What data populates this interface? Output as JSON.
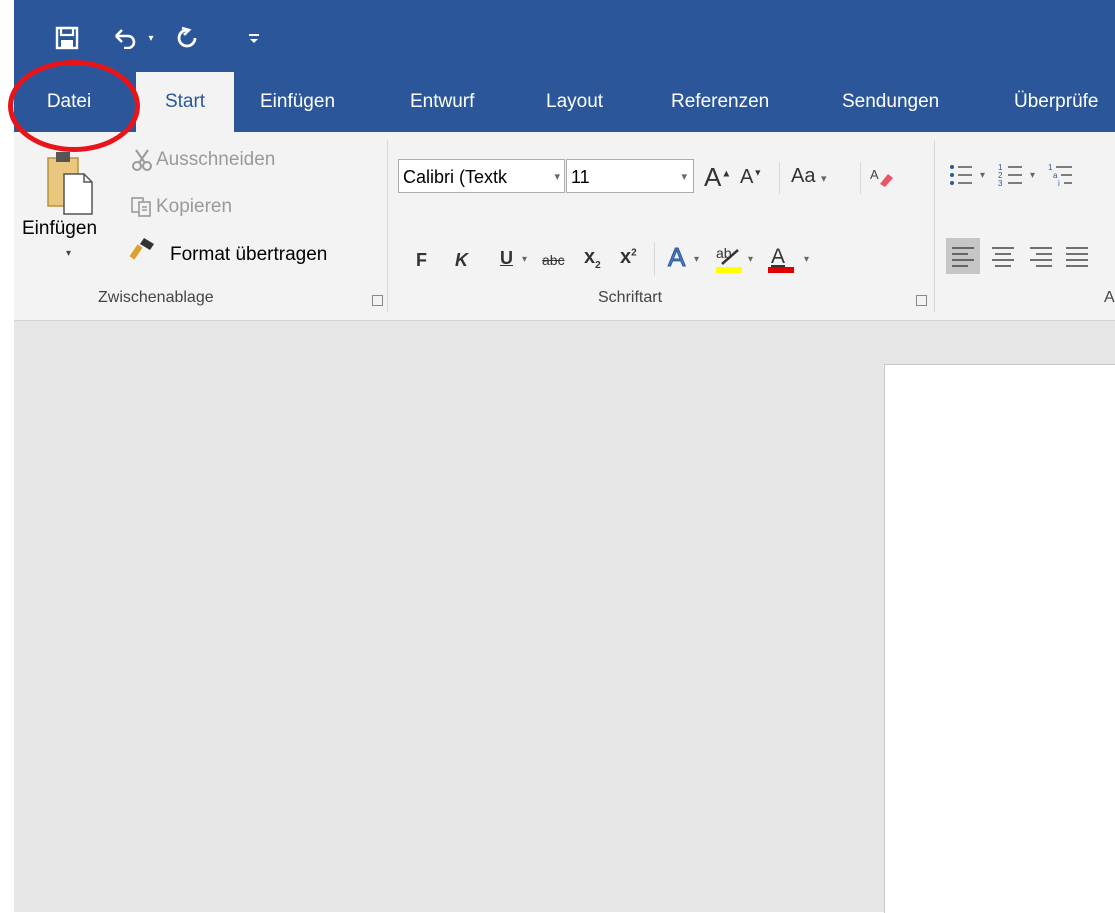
{
  "quick_access": {
    "save_icon": "save-icon",
    "undo_icon": "undo-icon",
    "redo_icon": "redo-icon",
    "customize_icon": "customize-qat-icon"
  },
  "tabs": [
    {
      "label": "Datei"
    },
    {
      "label": "Start"
    },
    {
      "label": "Einfügen"
    },
    {
      "label": "Entwurf"
    },
    {
      "label": "Layout"
    },
    {
      "label": "Referenzen"
    },
    {
      "label": "Sendungen"
    },
    {
      "label": "Überprüfe"
    }
  ],
  "clipboard": {
    "paste_label": "Einfügen",
    "cut_label": "Ausschneiden",
    "copy_label": "Kopieren",
    "format_painter_label": "Format übertragen",
    "group_label": "Zwischenablage"
  },
  "font": {
    "font_name": "Calibri (Textk",
    "font_size": "11",
    "bold": "F",
    "italic": "K",
    "underline": "U",
    "strike": "abc",
    "subscript": "x",
    "superscript": "x",
    "case_label": "Aa",
    "grow_label": "A",
    "shrink_label": "A",
    "group_label": "Schriftart"
  },
  "paragraph": {
    "group_label": "A"
  },
  "colors": {
    "accent": "#2b579a",
    "annotation": "#e8141a",
    "highlight": "#ffff00",
    "font_color": "#e00000"
  }
}
